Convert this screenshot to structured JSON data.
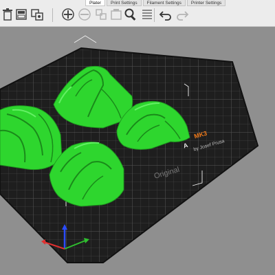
{
  "tabs": [
    {
      "label": "Plater",
      "active": true
    },
    {
      "label": "Print Settings",
      "active": false
    },
    {
      "label": "Filament Settings",
      "active": false
    },
    {
      "label": "Printer Settings",
      "active": false
    }
  ],
  "toolbar": {
    "tools": [
      "delete-icon",
      "delete-all-icon",
      "arrange-icon",
      "copy-icon",
      "paste-icon",
      "add-instance-icon",
      "remove-instance-icon",
      "split-objects-icon",
      "split-parts-icon",
      "search-icon",
      "layers-icon",
      "undo-icon",
      "redo-icon"
    ]
  },
  "bed": {
    "label_text": "Original",
    "label_model": "MK3",
    "label_by": "by Josef Prusa",
    "label_brand_partial": "A"
  },
  "colors": {
    "model": "#2ed62e",
    "bed": "#2a2a2a",
    "grid": "#4a4a4a",
    "accent": "#f07a1a"
  }
}
